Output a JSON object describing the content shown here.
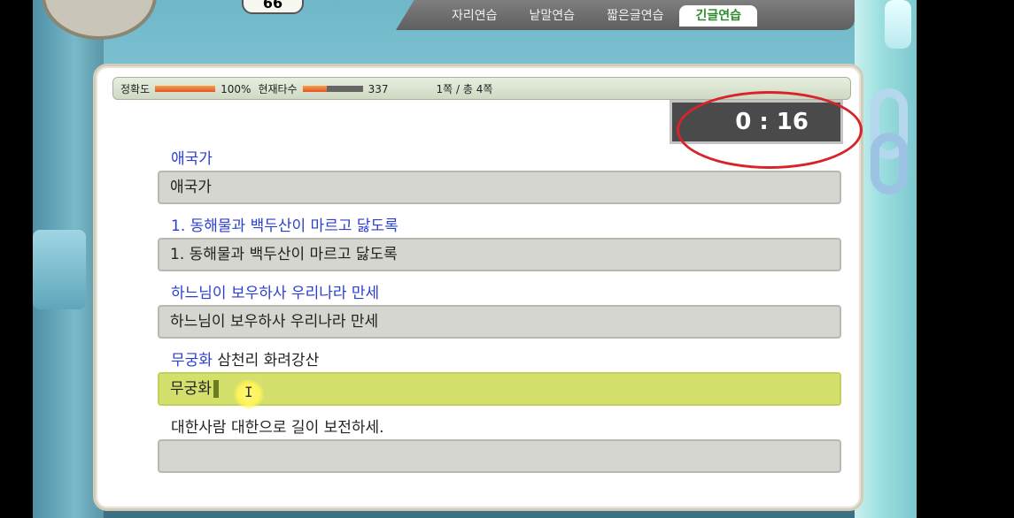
{
  "header": {
    "counter": "66",
    "tabs": [
      "자리연습",
      "낱말연습",
      "짧은글연습",
      "긴글연습"
    ],
    "active_tab_index": 3
  },
  "status": {
    "accuracy_label": "정확도",
    "accuracy_value": "100%",
    "accuracy_fraction": 1.0,
    "speed_label": "현재타수",
    "speed_value": "337",
    "speed_fraction": 0.4,
    "pages": "1쪽 / 총 4쪽"
  },
  "timer": "0 : 16",
  "lines": [
    {
      "prompt": "애국가",
      "typed": "애국가"
    },
    {
      "prompt": "1. 동해물과 백두산이 마르고 닳도록",
      "typed": "1. 동해물과 백두산이 마르고 닳도록"
    },
    {
      "prompt": "하느님이 보우하사 우리나라 만세",
      "typed": "하느님이 보우하사 우리나라 만세"
    },
    {
      "prompt_typed": "무궁화",
      "prompt_rest": " 삼천리 화려강산",
      "typed": "무궁화"
    },
    {
      "prompt": "대한사람 대한으로 길이 보전하세.",
      "typed": ""
    }
  ],
  "colors": {
    "prompt_typed": "#2b3fd1",
    "active_input": "#d4e06c",
    "timer_ring": "#d9232a"
  }
}
